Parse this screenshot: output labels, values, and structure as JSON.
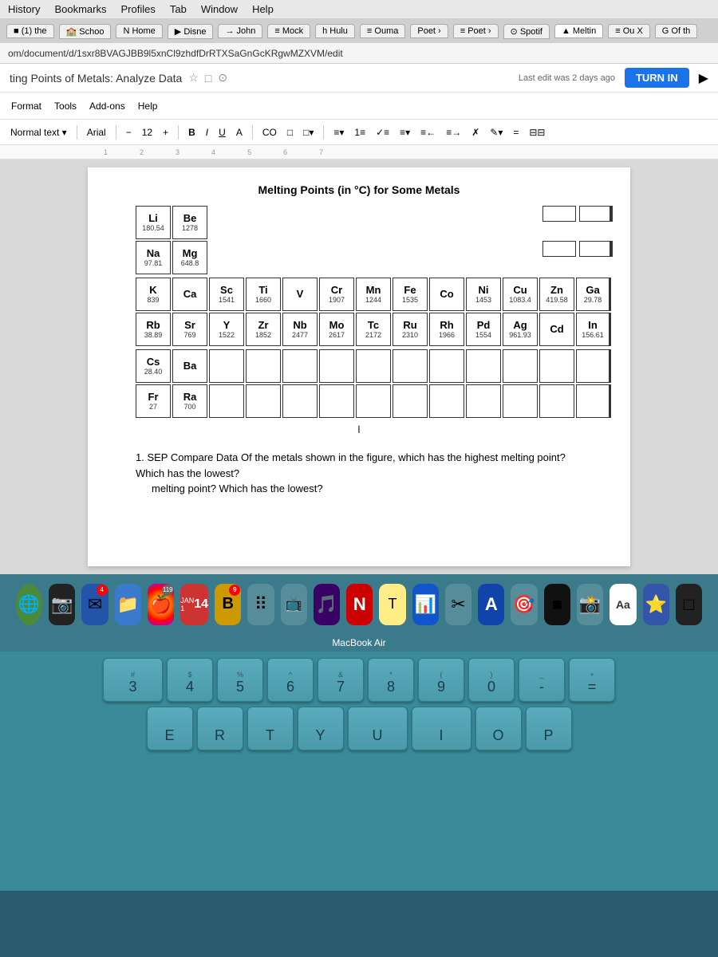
{
  "menubar": {
    "items": [
      "History",
      "Bookmarks",
      "Profiles",
      "Tab",
      "Window",
      "Help"
    ]
  },
  "tabbar": {
    "tabs": [
      {
        "label": "(1) the",
        "active": false
      },
      {
        "label": "Schoo",
        "active": false
      },
      {
        "label": "Home",
        "active": false
      },
      {
        "label": "Disne",
        "active": false
      },
      {
        "label": "John",
        "active": false
      },
      {
        "label": "Mock",
        "active": false
      },
      {
        "label": "h Hulu",
        "active": false
      },
      {
        "label": "Ouma",
        "active": false
      },
      {
        "label": "Poet",
        "active": false
      },
      {
        "label": "Poet",
        "active": false
      },
      {
        "label": "Spotif",
        "active": false
      },
      {
        "label": "Meltin",
        "active": true
      },
      {
        "label": "Ou X",
        "active": false
      },
      {
        "label": "G Of th",
        "active": false
      }
    ]
  },
  "addressbar": {
    "url": "om/document/d/1sxr8BVAGJBB9l5xnCl9zhdfDrRTXSaGnGcKRgwMZXVM/edit"
  },
  "doc": {
    "title": "ting Points of Metals: Analyze Data",
    "last_edit": "Last edit was 2 days ago",
    "turn_in_label": "TURN IN",
    "toolbar_items": [
      "Format",
      "Tools",
      "Add-ons",
      "Help"
    ],
    "font": "Arial",
    "font_size": "12",
    "chart_title": "Melting Points (in °C) for Some Metals",
    "question": "1. SEP Compare Data  Of the metals shown in the figure, which has the highest melting point? Which has the lowest?",
    "elements": [
      {
        "row": 1,
        "cells": [
          {
            "symbol": "Li",
            "value": "180.54"
          },
          {
            "symbol": "Be",
            "value": "1278"
          }
        ]
      },
      {
        "row": 2,
        "cells": [
          {
            "symbol": "Na",
            "value": "97.81"
          },
          {
            "symbol": "Mg",
            "value": "648.8"
          }
        ]
      },
      {
        "row": 3,
        "cells": [
          {
            "symbol": "K",
            "value": "839"
          },
          {
            "symbol": "Ca",
            "value": ""
          },
          {
            "symbol": "Sc",
            "value": "1541"
          },
          {
            "symbol": "Ti",
            "value": "1660"
          },
          {
            "symbol": "V",
            "value": ""
          },
          {
            "symbol": "Cr",
            "value": "1907"
          },
          {
            "symbol": "Mn",
            "value": "1244"
          },
          {
            "symbol": "Fe",
            "value": "1535"
          },
          {
            "symbol": "Co",
            "value": ""
          },
          {
            "symbol": "Ni",
            "value": "1453"
          },
          {
            "symbol": "Cu",
            "value": "1083.4"
          },
          {
            "symbol": "Zn",
            "value": "419.58"
          },
          {
            "symbol": "Ga",
            "value": "29.78"
          }
        ]
      },
      {
        "row": 4,
        "cells": [
          {
            "symbol": "Rb",
            "value": "38.89"
          },
          {
            "symbol": "Sr",
            "value": "769"
          },
          {
            "symbol": "Y",
            "value": "1522"
          },
          {
            "symbol": "Zr",
            "value": "1852"
          },
          {
            "symbol": "Nb",
            "value": "2477"
          },
          {
            "symbol": "Mo",
            "value": "2617"
          },
          {
            "symbol": "Tc",
            "value": "2172"
          },
          {
            "symbol": "Ru",
            "value": "2310"
          },
          {
            "symbol": "Rh",
            "value": "1966"
          },
          {
            "symbol": "Pd",
            "value": "1554"
          },
          {
            "symbol": "Ag",
            "value": "961.93"
          },
          {
            "symbol": "Cd",
            "value": ""
          },
          {
            "symbol": "In",
            "value": "156.61"
          }
        ]
      },
      {
        "row": 5,
        "cells": [
          {
            "symbol": "Cs",
            "value": "28.40"
          },
          {
            "symbol": "Ba",
            "value": ""
          }
        ]
      },
      {
        "row": 6,
        "cells": [
          {
            "symbol": "Fr",
            "value": "27"
          },
          {
            "symbol": "Ra",
            "value": "700"
          }
        ]
      }
    ]
  },
  "dock": {
    "items": [
      "🌐",
      "📷",
      "✉",
      "📁",
      "🍎",
      "🎬",
      "📅",
      "📋",
      "📺",
      "🎵",
      "N",
      "T",
      "📊",
      "✂",
      "A",
      "🎯",
      "■",
      "📸",
      "Aa",
      "⭐"
    ]
  },
  "macbook_label": "MacBook Air",
  "keyboard": {
    "rows": [
      [
        {
          "top": "",
          "main": "3"
        },
        {
          "top": "",
          "main": "4"
        },
        {
          "top": "",
          "main": "5"
        },
        {
          "top": "",
          "main": "6"
        },
        {
          "top": "&",
          "main": "7"
        },
        {
          "top": "",
          "main": "8"
        },
        {
          "top": "",
          "main": "9"
        },
        {
          "top": "",
          "main": "0"
        },
        {
          "top": "",
          "main": "-"
        },
        {
          "top": "",
          "main": "="
        }
      ],
      [
        {
          "top": "",
          "main": "E"
        },
        {
          "top": "",
          "main": "R"
        },
        {
          "top": "",
          "main": "T"
        },
        {
          "top": "",
          "main": "Y"
        },
        {
          "top": "",
          "main": "U"
        },
        {
          "top": "",
          "main": "I"
        },
        {
          "top": "",
          "main": "O"
        },
        {
          "top": "",
          "main": "P"
        }
      ]
    ]
  }
}
